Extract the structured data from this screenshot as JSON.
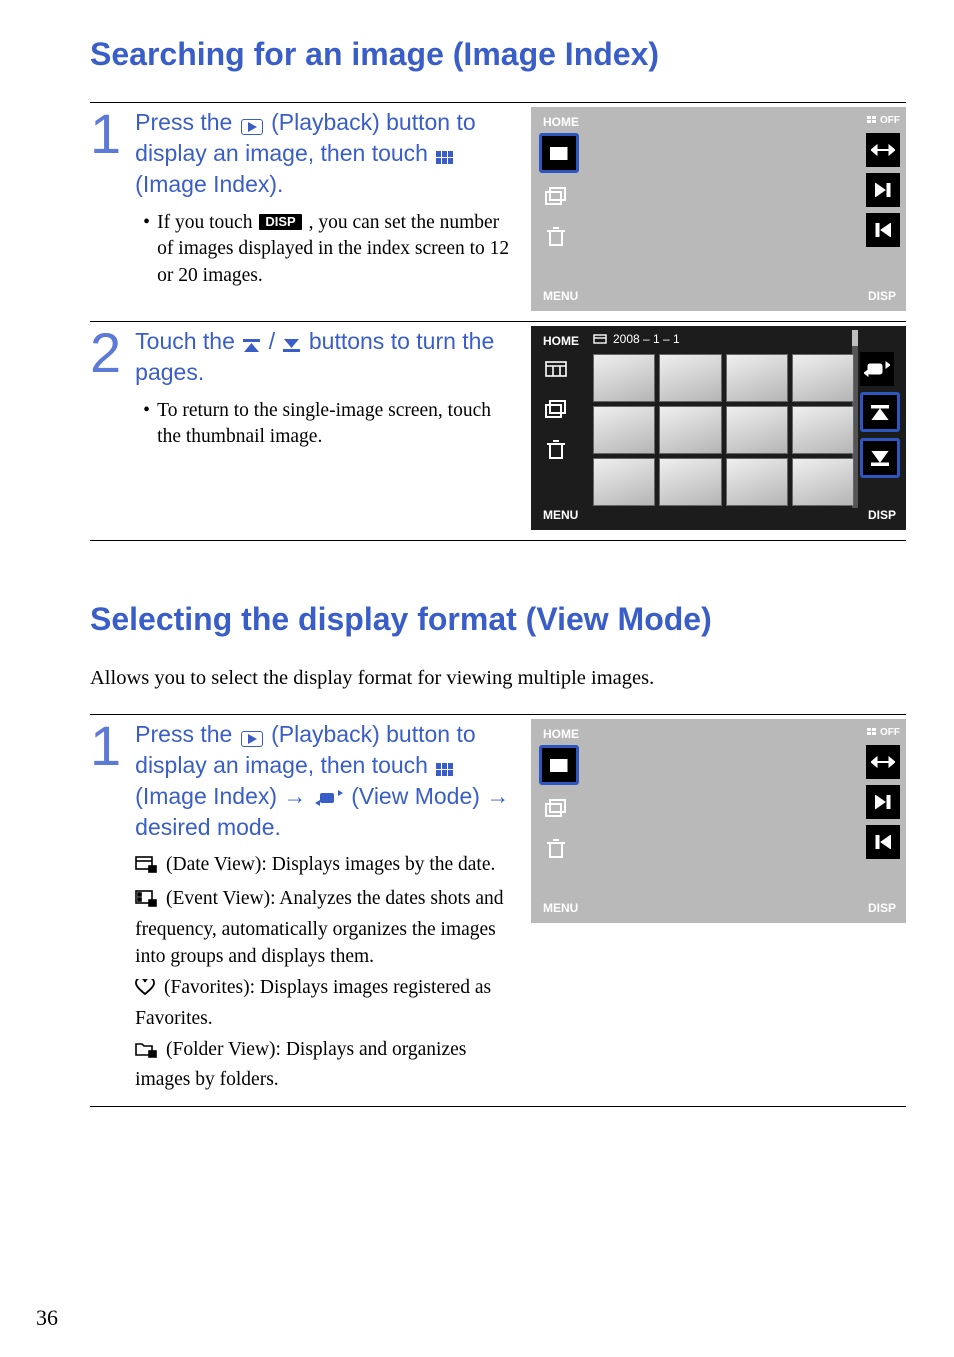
{
  "page_number": "36",
  "section1": {
    "title": "Searching for an image (Image Index)",
    "step1": {
      "num": "1",
      "text_a": "Press the ",
      "text_b": " (Playback) button to display an image, then touch ",
      "text_c": " (Image Index).",
      "bullet_a": "If you touch ",
      "bullet_b": ", you can set the number of images displayed in the index screen to 12 or 20 images.",
      "disp_badge": "DISP"
    },
    "step2": {
      "num": "2",
      "text_a": "Touch the ",
      "text_b": "/",
      "text_c": " buttons to turn the pages.",
      "bullet": "To return to the single-image screen, touch the thumbnail image."
    }
  },
  "section2": {
    "title": "Selecting the display format (View Mode)",
    "intro": "Allows you to select the display format for viewing multiple images.",
    "step1": {
      "num": "1",
      "text_a": "Press the ",
      "text_b": " (Playback) button to display an image, then touch ",
      "text_c": " (Image Index) ",
      "arrow1": "→ ",
      "text_d": " (View Mode) ",
      "arrow2": "→",
      "text_e": " desired mode.",
      "desc": [
        {
          "label": "(Date View)",
          "text": ": Displays images by the date."
        },
        {
          "label": "(Event View)",
          "text": ": Analyzes the dates shots and frequency, automatically organizes the images into groups and displays them."
        },
        {
          "label": "(Favorites)",
          "text": ": Displays images registered as Favorites."
        },
        {
          "label": "(Folder View)",
          "text": ": Displays and organizes images by folders."
        }
      ]
    }
  },
  "screens": {
    "home": "HOME",
    "menu": "MENU",
    "disp": "DISP",
    "off": "OFF",
    "date": "2008 – 1 – 1"
  }
}
